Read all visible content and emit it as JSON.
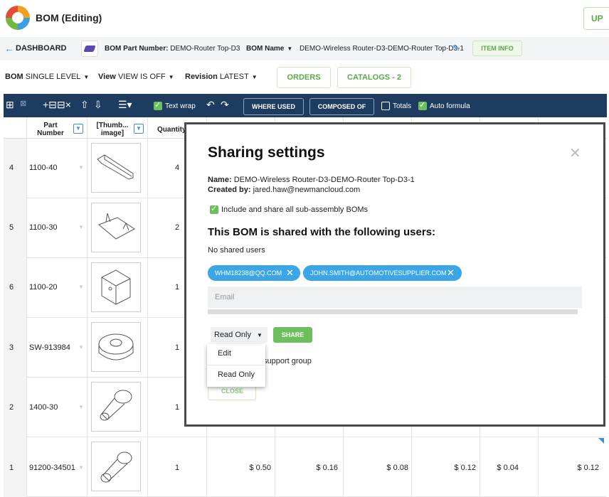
{
  "header": {
    "title": "BOM (Editing)",
    "right_button": "UP"
  },
  "breadcrumb": {
    "dashboard": "DASHBOARD",
    "part_number_label": "BOM Part Number:",
    "part_number": "DEMO-Router Top-D3",
    "bom_name_label": "BOM Name",
    "bom_name": "DEMO-Wireless Router-D3-DEMO-Router Top-D3-1",
    "item_info": "ITEM INFO"
  },
  "view_row": {
    "bom_label": "BOM",
    "bom_value": "SINGLE LEVEL",
    "view_label": "View",
    "view_value": "VIEW IS OFF",
    "revision_label": "Revision",
    "revision_value": "LATEST",
    "orders": "ORDERS",
    "catalogs": "CATALOGS - 2"
  },
  "toolbar": {
    "text_wrap": "Text wrap",
    "where_used": "WHERE USED",
    "composed_of": "COMPOSED OF",
    "totals": "Totals",
    "auto_formula": "Auto formula"
  },
  "table": {
    "headers": {
      "part_number": "Part Number",
      "thumbnail": "[Thumb... image]",
      "quantity": "Quantity"
    },
    "rows": [
      {
        "num": "4",
        "part": "1100-40",
        "qty": "4"
      },
      {
        "num": "5",
        "part": "1100-30",
        "qty": "2"
      },
      {
        "num": "6",
        "part": "1100-20",
        "qty": "1"
      },
      {
        "num": "3",
        "part": "SW-913984",
        "qty": "1"
      },
      {
        "num": "2",
        "part": "1400-30",
        "qty": "1"
      },
      {
        "num": "1",
        "part": "91200-34501",
        "qty": "1"
      }
    ],
    "last_row_prices": [
      "$ 0.50",
      "$ 0.16",
      "$ 0.08",
      "$ 0.12",
      "$ 0.04",
      "$ 0.12"
    ]
  },
  "modal": {
    "title": "Sharing settings",
    "name_label": "Name:",
    "name_value": "DEMO-Wireless Router-D3-DEMO-Router Top-D3-1",
    "created_label": "Created by:",
    "created_value": "jared.haw@newmancloud.com",
    "include_sub": "Include and share all sub-assembly BOMs",
    "shared_heading": "This BOM is shared with the following users:",
    "no_users": "No shared users",
    "chips": [
      "WHM18238@QQ.COM",
      "JOHN.SMITH@AUTOMOTIVESUPPLIER.COM"
    ],
    "email_placeholder": "Email",
    "permission": "Read Only",
    "share": "SHARE",
    "support_group": "support group",
    "close": "CLOSE",
    "dropdown_options": [
      "Edit",
      "Read Only"
    ]
  }
}
